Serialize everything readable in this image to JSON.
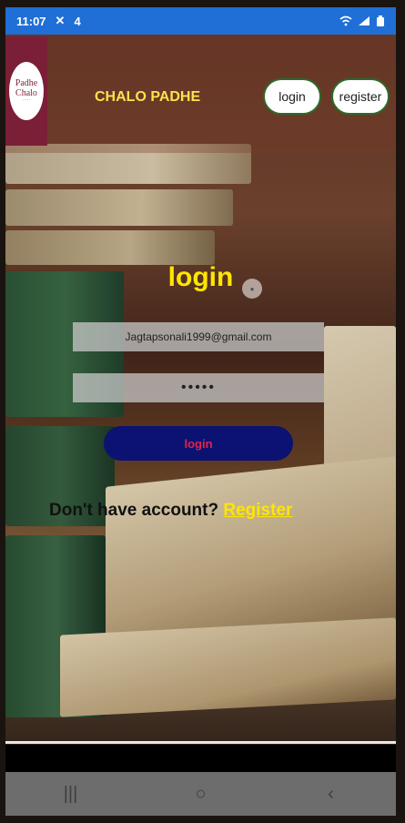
{
  "status_bar": {
    "time": "11:07",
    "notif_glyph": "✕",
    "notif_count": "4",
    "icons": [
      "wifi-icon",
      "signal-icon",
      "battery-icon"
    ]
  },
  "header": {
    "logo_line1": "Padhe",
    "logo_line2": "Chalo",
    "title": "CHALO PADHE",
    "login_label": "login",
    "register_label": "register"
  },
  "form": {
    "title": "login",
    "email_value": "Jagtapsonali1999@gmail.com",
    "password_value": "•••••",
    "submit_label": "login",
    "no_account_text": "Don't have account? ",
    "register_link": "Register"
  },
  "nav": {
    "recents_glyph": "|||",
    "home_glyph": "○",
    "back_glyph": "‹"
  },
  "colors": {
    "status_bar": "#1f6fd6",
    "title_yellow": "#ffe600",
    "button_navy": "#0c1272",
    "button_text": "#e2234a",
    "logo_bg": "#7a1f35"
  }
}
